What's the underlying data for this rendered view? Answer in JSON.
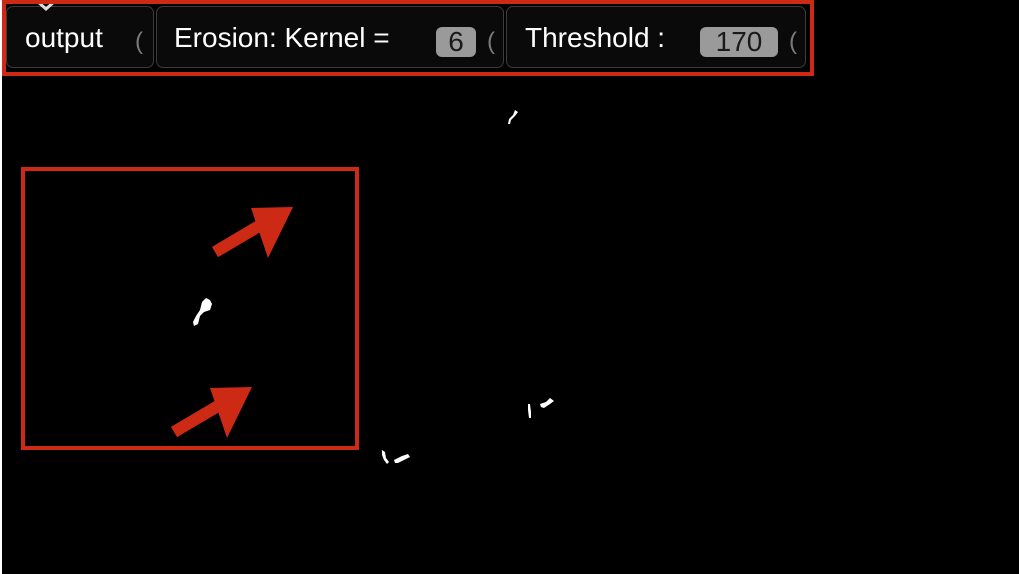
{
  "output_node": {
    "label": "output"
  },
  "erosion": {
    "label": "Erosion: Kernel =",
    "kernel_value": "6"
  },
  "threshold": {
    "label": "Threshold :",
    "value": "170"
  },
  "colors": {
    "annotation": "#cc2a14",
    "background": "#000000",
    "value_box": "#9a9a9a"
  },
  "icons": {
    "arrow": "arrow-up-right-icon",
    "paren": "parenthesis-glyph"
  }
}
